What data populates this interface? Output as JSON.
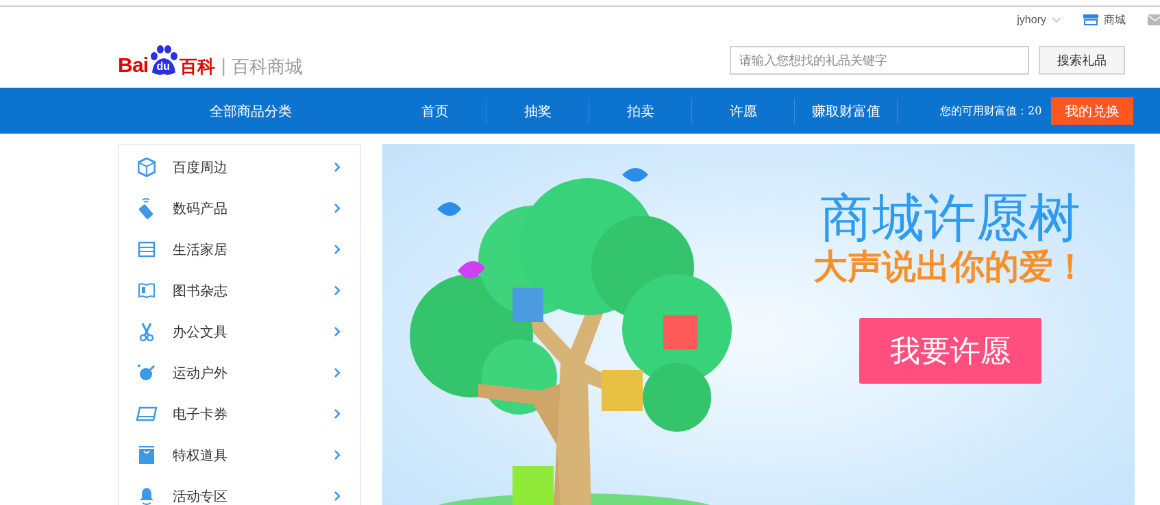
{
  "top_bar": {
    "username": "jyhory",
    "mall_link": "商城"
  },
  "header": {
    "logo_brand": "Bai",
    "logo_paw_text": "du",
    "logo_site": "百科",
    "logo_separator": "|",
    "logo_subtitle": "百科商城",
    "search": {
      "placeholder": "请输入您想找的礼品关键字"
    },
    "search_button": "搜索礼品"
  },
  "nav": {
    "category_title": "全部商品分类",
    "items": [
      {
        "label": "首页",
        "selected": false
      },
      {
        "label": "抽奖",
        "selected": false
      },
      {
        "label": "拍卖",
        "selected": false
      },
      {
        "label": "许愿",
        "selected": false
      },
      {
        "label": "赚取财富值",
        "selected": false
      }
    ],
    "wealth_label": "您的可用财富值：20",
    "exchange_button": "我的兑换"
  },
  "sidebar": {
    "items": [
      {
        "label": "百度周边",
        "kind": "box"
      },
      {
        "label": "数码产品",
        "kind": "phone"
      },
      {
        "label": "生活家居",
        "kind": "cabinet"
      },
      {
        "label": "图书杂志",
        "kind": "book"
      },
      {
        "label": "办公文具",
        "kind": "scissors"
      },
      {
        "label": "运动户外",
        "kind": "ball"
      },
      {
        "label": "电子卡券",
        "kind": "card"
      },
      {
        "label": "特权道具",
        "kind": "bag"
      },
      {
        "label": "活动专区",
        "kind": "bell"
      }
    ]
  },
  "banner": {
    "title": "商城许愿树",
    "subtitle": "大声说出你的爱！",
    "button": "我要许愿"
  }
}
